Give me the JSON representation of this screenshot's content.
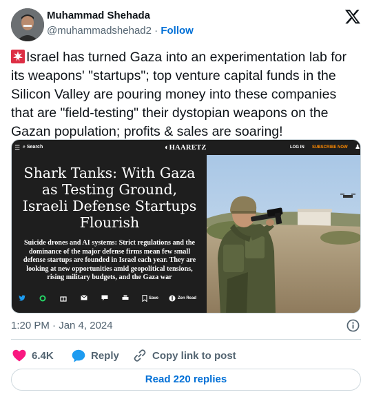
{
  "author": {
    "name": "Muhammad Shehada",
    "handle": "@muhammadshehad2",
    "separator": "·",
    "follow_label": "Follow"
  },
  "tweet": {
    "text": "Israel has turned Gaza into an experimentation lab for its weapons' \"startups\"; top venture capital funds in the Silicon Valley are pouring money into these companies that are \"field-testing\" their dystopian weapons on the Gazan population; profits & sales are soaring!"
  },
  "media": {
    "search_label": "Search",
    "logo": "HAARETZ",
    "login_label": "LOG IN",
    "subscribe_label": "SUBSCRIBE NOW",
    "headline": "Shark Tanks: With Gaza as Testing Ground, Israeli Defense Startups Flourish",
    "subheadline": "Suicide drones and AI systems: Strict regulations and the dominance of the major defense firms mean few small defense startups are founded in Israel each year. They are looking at new opportunities amid geopolitical tensions, rising military budgets, and the Gaza war",
    "save_label": "Save",
    "zen_label": "Zen Read"
  },
  "timestamp": "1:20 PM · Jan 4, 2024",
  "actions": {
    "like_count": "6.4K",
    "reply_label": "Reply",
    "copy_label": "Copy link to post"
  },
  "read_replies_label": "Read 220 replies",
  "colors": {
    "link_blue": "#006fd6",
    "like_red": "#f91880",
    "reply_blue": "#1d9bf0",
    "secondary_text": "#536471",
    "haaretz_bg": "#1e1e1e",
    "subscribe_orange": "#ff8a00"
  },
  "icons": [
    "x-logo-icon",
    "siren-emoji-icon",
    "info-icon",
    "heart-icon",
    "speech-bubble-icon",
    "link-icon"
  ]
}
